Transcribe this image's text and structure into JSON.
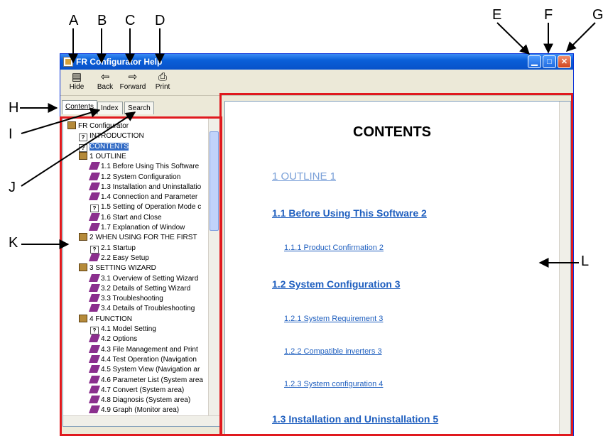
{
  "callouts": [
    "A",
    "B",
    "C",
    "D",
    "E",
    "F",
    "G",
    "H",
    "I",
    "J",
    "K",
    "L"
  ],
  "window": {
    "title": "FR Configurator Help"
  },
  "toolbar": {
    "hide": "Hide",
    "back": "Back",
    "forward": "Forward",
    "print": "Print"
  },
  "tabs": {
    "contents": "Contents",
    "index": "Index",
    "search": "Search"
  },
  "tree": [
    "FR Configurator",
    "INTRODUCTION",
    "CONTENTS",
    "1 OUTLINE",
    "1.1 Before Using This Software",
    "1.2 System Configuration",
    "1.3 Installation and Uninstallatio",
    "1.4 Connection and Parameter",
    "1.5 Setting of Operation Mode c",
    "1.6 Start and Close",
    "1.7 Explanation of Window",
    "2 WHEN USING FOR THE FIRST",
    "2.1 Startup",
    "2.2 Easy Setup",
    "3 SETTING WIZARD",
    "3.1 Overview of Setting Wizard",
    "3.2 Details of Setting Wizard",
    "3.3 Troubleshooting",
    "3.4 Details of Troubleshooting",
    "4 FUNCTION",
    "4.1 Model Setting",
    "4.2 Options",
    "4.3 File Management and Print",
    "4.4 Test Operation (Navigation",
    "4.5 System View (Navigation ar",
    "4.6 Parameter List (System area",
    "4.7 Convert (System area)",
    "4.8 Diagnosis (System area)",
    "4.9 Graph (Monitor area)"
  ],
  "content": {
    "heading": "CONTENTS",
    "outline": "1 OUTLINE 1",
    "s11": "1.1 Before Using This Software 2",
    "s111": "1.1.1 Product Confirmation 2",
    "s12": "1.2 System Configuration 3",
    "s121": "1.2.1 System Requirement 3",
    "s122": "1.2.2 Compatible inverters 3",
    "s123": "1.2.3 System configuration 4",
    "s13": "1.3 Installation and Uninstallation 5"
  }
}
